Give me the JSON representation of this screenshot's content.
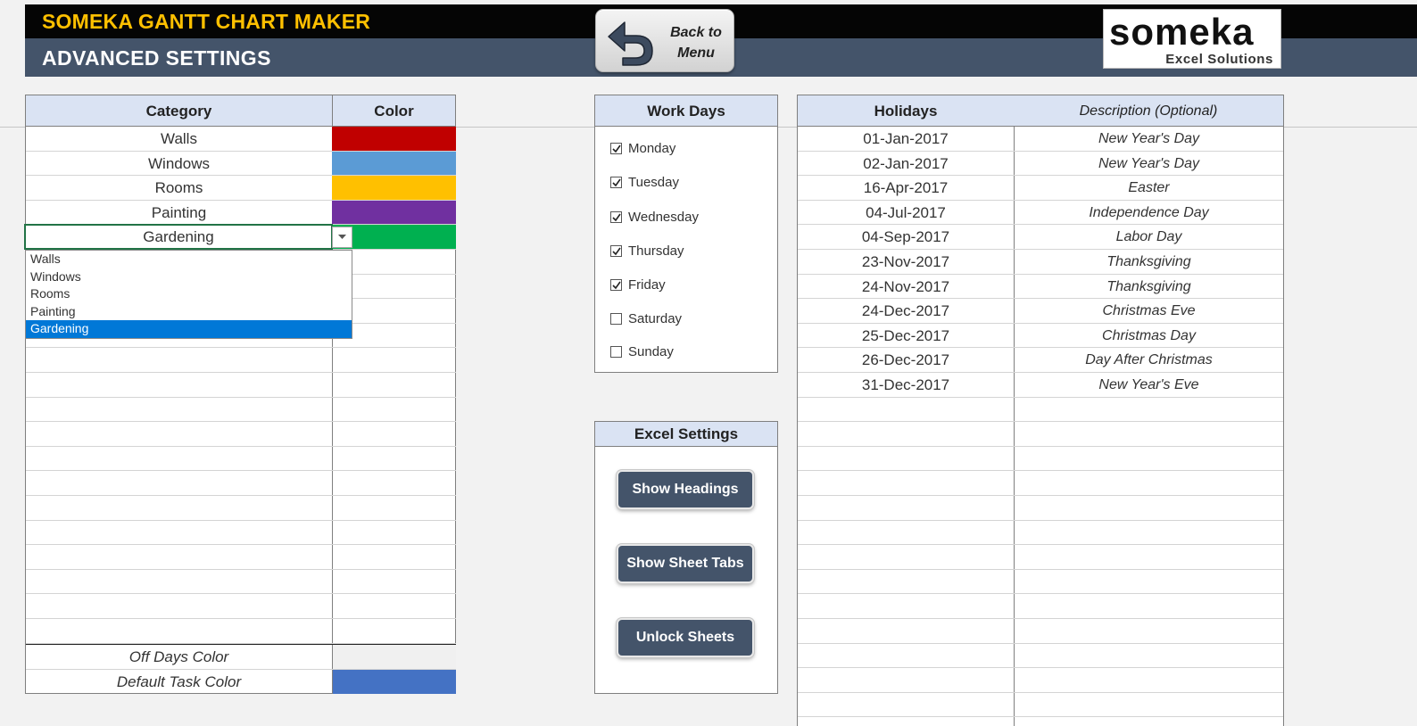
{
  "header": {
    "app_title": "SOMEKA GANTT CHART MAKER",
    "page_title": "ADVANCED SETTINGS",
    "back_button": {
      "line1": "Back to",
      "line2": "Menu"
    },
    "logo": {
      "name": "someka",
      "tagline": "Excel Solutions"
    }
  },
  "category_table": {
    "headers": {
      "category": "Category",
      "color": "Color"
    },
    "rows": [
      {
        "category": "Walls",
        "color": "#c00000"
      },
      {
        "category": "Windows",
        "color": "#5b9bd5"
      },
      {
        "category": "Rooms",
        "color": "#ffc000"
      },
      {
        "category": "Painting",
        "color": "#7030a0"
      },
      {
        "category": "Gardening",
        "color": "#00b050"
      }
    ],
    "footer": [
      {
        "label": "Off Days Color",
        "color": "#f0f0f0"
      },
      {
        "label": "Default Task Color",
        "color": "#4472c4"
      }
    ]
  },
  "dropdown": {
    "value": "Gardening",
    "options": [
      "Walls",
      "Windows",
      "Rooms",
      "Painting",
      "Gardening"
    ],
    "selected_index": 4
  },
  "work_days": {
    "title": "Work Days",
    "days": [
      {
        "label": "Monday",
        "checked": true
      },
      {
        "label": "Tuesday",
        "checked": true
      },
      {
        "label": "Wednesday",
        "checked": true
      },
      {
        "label": "Thursday",
        "checked": true
      },
      {
        "label": "Friday",
        "checked": true
      },
      {
        "label": "Saturday",
        "checked": false
      },
      {
        "label": "Sunday",
        "checked": false
      }
    ]
  },
  "excel_settings": {
    "title": "Excel Settings",
    "buttons": [
      "Show Headings",
      "Show Sheet Tabs",
      "Unlock Sheets"
    ]
  },
  "holidays": {
    "headers": {
      "date": "Holidays",
      "description": "Description (Optional)"
    },
    "rows": [
      {
        "date": "01-Jan-2017",
        "description": "New Year's Day"
      },
      {
        "date": "02-Jan-2017",
        "description": "New Year's Day"
      },
      {
        "date": "16-Apr-2017",
        "description": "Easter"
      },
      {
        "date": "04-Jul-2017",
        "description": "Independence Day"
      },
      {
        "date": "04-Sep-2017",
        "description": "Labor Day"
      },
      {
        "date": "23-Nov-2017",
        "description": "Thanksgiving"
      },
      {
        "date": "24-Nov-2017",
        "description": "Thanksgiving"
      },
      {
        "date": "24-Dec-2017",
        "description": "Christmas Eve"
      },
      {
        "date": "25-Dec-2017",
        "description": "Christmas Day"
      },
      {
        "date": "26-Dec-2017",
        "description": "Day After Christmas"
      },
      {
        "date": "31-Dec-2017",
        "description": "New Year's Eve"
      }
    ]
  }
}
